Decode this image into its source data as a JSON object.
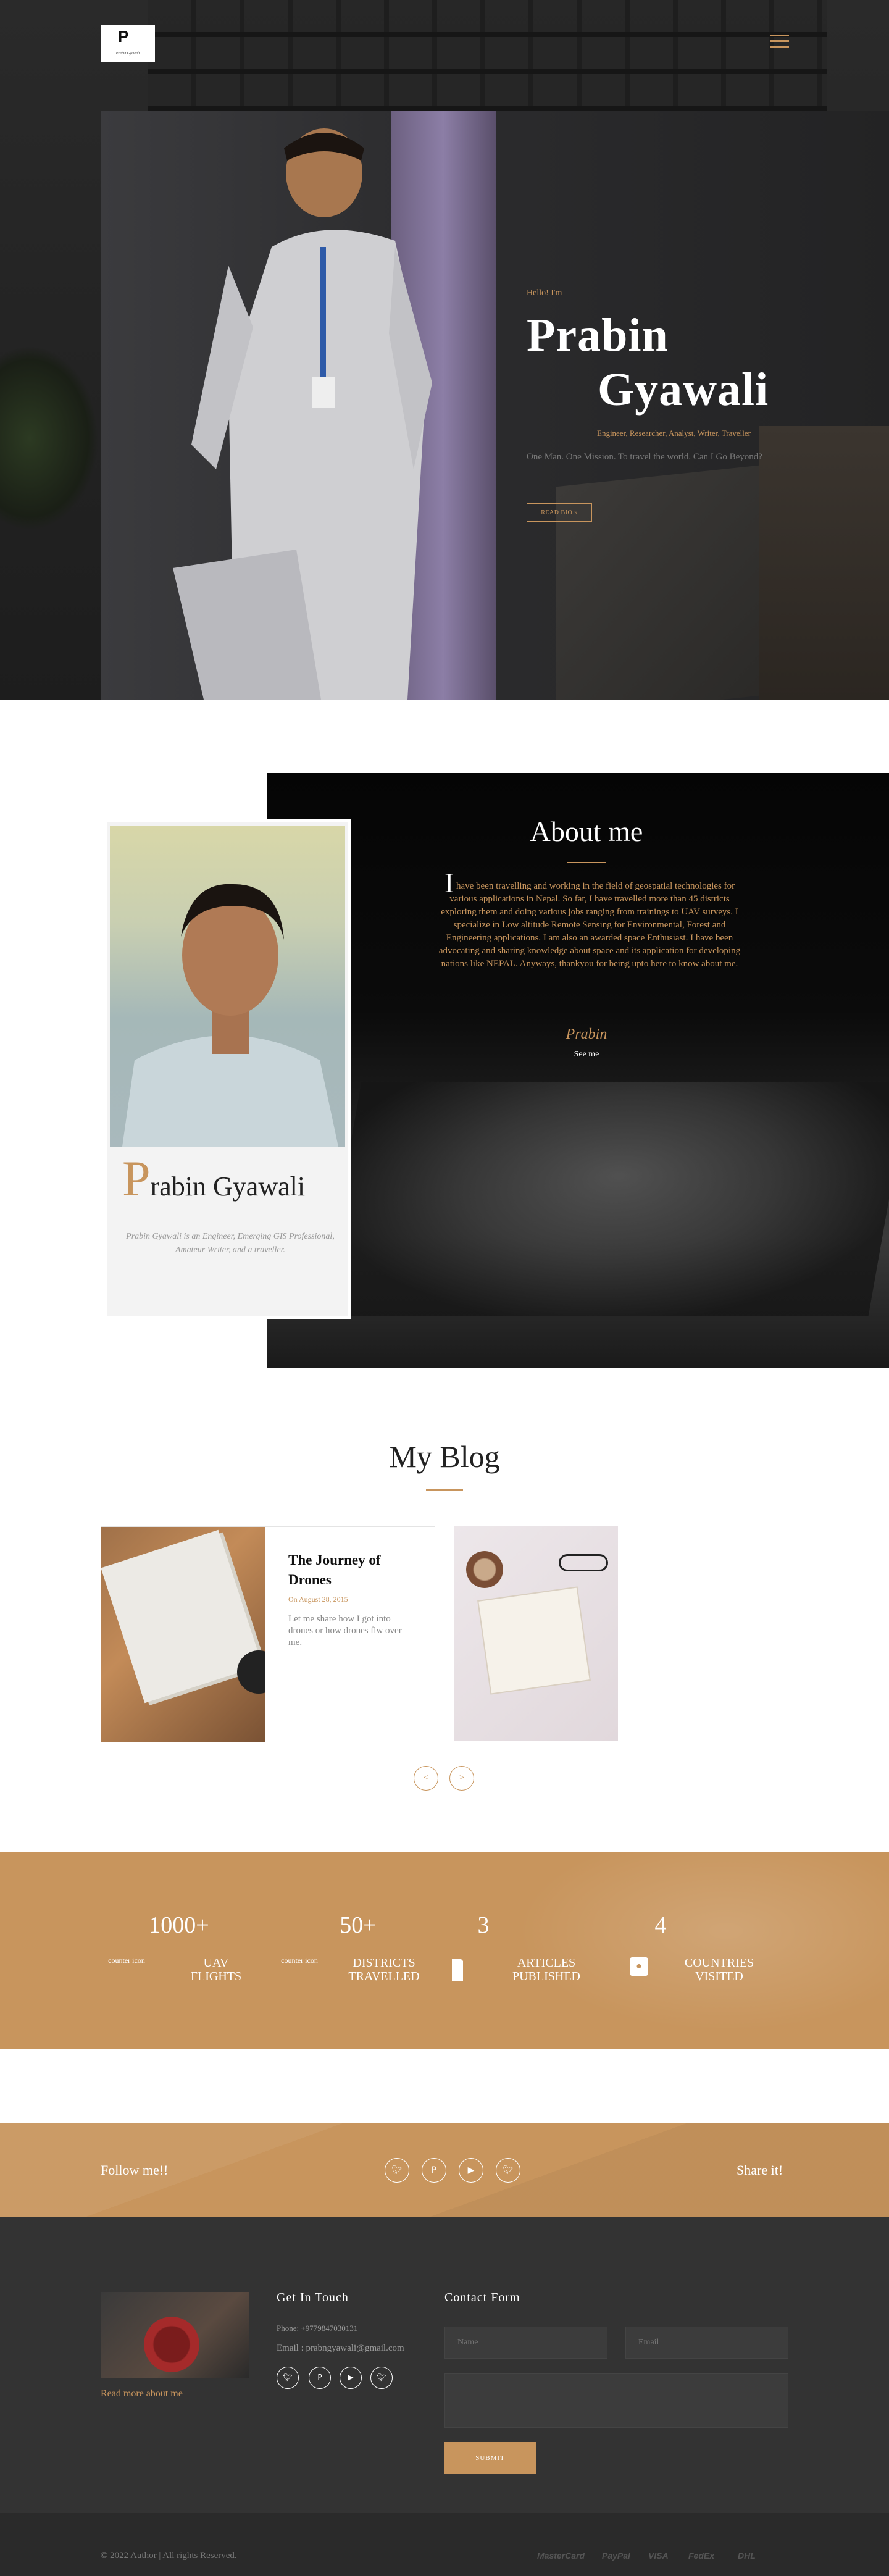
{
  "header": {
    "logo_letter": "P",
    "logo_text": "Prabin Gyawali",
    "menu_icon": "hamburger-icon"
  },
  "hero": {
    "greeting": "Hello! I'm",
    "first_name": "Prabin",
    "last_name": "Gyawali",
    "roles": "Engineer, Researcher, Analyst, Writer, Traveller",
    "tagline": "One Man. One Mission. To travel the world. Can I Go Beyond?",
    "cta_label": "READ BIO »"
  },
  "about": {
    "title": "About me",
    "drop_cap": "I",
    "text": " have been travelling and working in the field of geospatial technologies for various applications in Nepal. So far, I have travelled more than 45 districts exploring them and doing various jobs ranging from trainings to UAV surveys. I specialize in Low altitude Remote Sensing for Environmental, Forest and Engineering applications. I am also an awarded space Enthusiast. I have been advocating and sharing knowledge about space and its application for developing nations like NEPAL. Anyways, thankyou for being upto here to know about me.",
    "signature": "Prabin",
    "see_me": "See me"
  },
  "profile": {
    "name_initial": "P",
    "name_rest": "rabin Gyawali",
    "description": "Prabin Gyawali is an Engineer, Emerging GIS Professional, Amateur Writer, and a traveller."
  },
  "blog": {
    "title": "My Blog",
    "post": {
      "title": "The Journey of Drones",
      "date": "On August 28, 2015",
      "excerpt": "Let me share how I got into drones or how drones flw over me."
    },
    "prev_label": "<",
    "next_label": ">"
  },
  "counters": [
    {
      "value": "1000+",
      "icon_alt": "counter icon",
      "label": "UAV FLIGHTS"
    },
    {
      "value": "50+",
      "icon_alt": "counter icon",
      "label": "DISTRICTS TRAVELLED"
    },
    {
      "value": "3",
      "icon_alt": "",
      "label": "ARTICLES PUBLISHED"
    },
    {
      "value": "4",
      "icon_alt": "",
      "label": "COUNTRIES VISITED"
    }
  ],
  "follow": {
    "follow_label": "Follow me!!",
    "share_label": "Share it!",
    "icons": [
      "twitter-icon",
      "pinterest-icon",
      "youtube-icon",
      "twitter-icon"
    ]
  },
  "footer": {
    "read_more": "Read more about me",
    "get_in_touch": "Get In Touch",
    "phone": "Phone: +9779847030131",
    "email": "Email : prabngyawali@gmail.com",
    "contact_form": "Contact Form",
    "name_placeholder": "Name",
    "email_placeholder": "Email",
    "submit_label": "SUBMIT",
    "copyright": "© 2022 Author | All rights Reserved.",
    "payments": [
      "MasterCard",
      "PayPal",
      "VISA",
      "FedEx",
      "DHL"
    ]
  },
  "colors": {
    "accent": "#c8955d",
    "dark": "#333333"
  }
}
